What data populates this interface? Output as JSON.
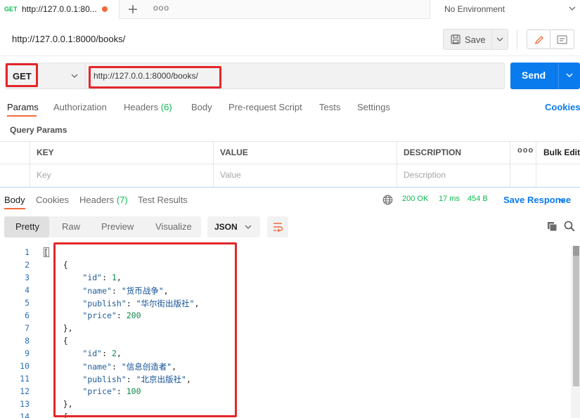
{
  "tab": {
    "method": "GET",
    "title": "http://127.0.0.1:80..."
  },
  "environment": {
    "label": "No Environment"
  },
  "request": {
    "title": "http://127.0.0.1:8000/books/",
    "method": "GET",
    "url": "http://127.0.0.1:8000/books/",
    "save_label": "Save",
    "send_label": "Send"
  },
  "request_tabs": {
    "params": "Params",
    "authorization": "Authorization",
    "headers": "Headers",
    "headers_count": "(6)",
    "body": "Body",
    "prerequest": "Pre-request Script",
    "tests": "Tests",
    "settings": "Settings",
    "cookies": "Cookies"
  },
  "query_params": {
    "title": "Query Params",
    "columns": [
      "KEY",
      "VALUE",
      "DESCRIPTION"
    ],
    "bulk_edit": "Bulk Edit",
    "placeholders": {
      "key": "Key",
      "value": "Value",
      "description": "Description"
    }
  },
  "response": {
    "tabs": {
      "body": "Body",
      "cookies": "Cookies",
      "headers": "Headers",
      "headers_count": "(7)",
      "test_results": "Test Results"
    },
    "status": "200 OK",
    "time": "17 ms",
    "size": "454 B",
    "save_response": "Save Response",
    "views": [
      "Pretty",
      "Raw",
      "Preview",
      "Visualize"
    ],
    "format": "JSON",
    "line_numbers": [
      "1",
      "2",
      "3",
      "4",
      "5",
      "6",
      "7",
      "8",
      "9",
      "10",
      "11",
      "12",
      "13",
      "14"
    ],
    "books": [
      {
        "id": "1",
        "name": "货币战争",
        "publish": "华尔街出版社",
        "price": "200"
      },
      {
        "id": "2",
        "name": "信息创造者",
        "publish": "北京出版社",
        "price": "100"
      }
    ],
    "keys": {
      "id": "\"id\"",
      "name": "\"name\"",
      "publish": "\"publish\"",
      "price": "\"price\""
    }
  },
  "colors": {
    "accent_orange": "#f26b3a",
    "send_blue": "#097bed",
    "status_green": "#0cbb52",
    "highlight_red": "#e3262a"
  }
}
